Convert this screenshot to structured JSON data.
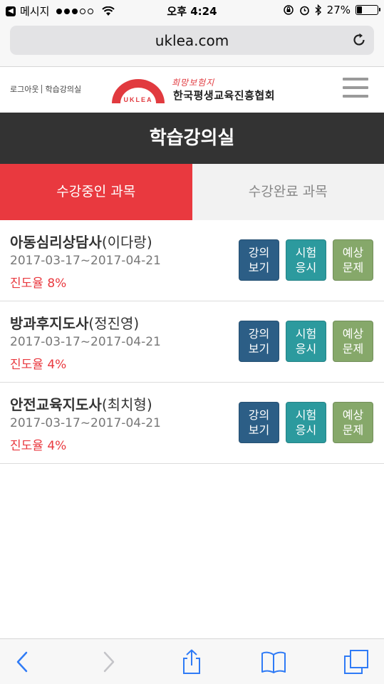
{
  "status_bar": {
    "back_app": "메시지",
    "time": "오후 4:24",
    "battery": "27%",
    "battery_level": 0.27
  },
  "browser": {
    "url": "uklea.com"
  },
  "header": {
    "login_link": "로그아웃",
    "classroom_link": "학습강의실",
    "logo_mark": "UKLEA",
    "logo_slogan": "희망보험지",
    "logo_name": "한국평생교육진흥협회"
  },
  "page": {
    "title": "학습강의실"
  },
  "tabs": [
    {
      "label": "수강중인 과목",
      "active": true
    },
    {
      "label": "수강완료 과목",
      "active": false
    }
  ],
  "courses": [
    {
      "name": "아동심리상담사",
      "instructor": "(이다랑)",
      "period": "2017-03-17~2017-04-21",
      "progress": "진도율 8%",
      "buttons": [
        {
          "line1": "강의",
          "line2": "보기"
        },
        {
          "line1": "시험",
          "line2": "응시"
        },
        {
          "line1": "예상",
          "line2": "문제"
        }
      ]
    },
    {
      "name": "방과후지도사",
      "instructor": "(정진영)",
      "period": "2017-03-17~2017-04-21",
      "progress": "진도율 4%",
      "buttons": [
        {
          "line1": "강의",
          "line2": "보기"
        },
        {
          "line1": "시험",
          "line2": "응시"
        },
        {
          "line1": "예상",
          "line2": "문제"
        }
      ]
    },
    {
      "name": "안전교육지도사",
      "instructor": "(최치형)",
      "period": "2017-03-17~2017-04-21",
      "progress": "진도율 4%",
      "buttons": [
        {
          "line1": "강의",
          "line2": "보기"
        },
        {
          "line1": "시험",
          "line2": "응시"
        },
        {
          "line1": "예상",
          "line2": "문제"
        }
      ]
    }
  ],
  "colors": {
    "accent_red": "#e9393f",
    "title_bar": "#333333",
    "lecture_button": "#2c5e86",
    "exam_button": "#2c9a9e",
    "preview_button": "#86a86a",
    "ios_blue": "#2f7bf6"
  },
  "icons": {
    "toolbar": [
      "back-arrow-icon",
      "forward-arrow-icon",
      "share-icon",
      "bookmarks-icon",
      "tabs-icon"
    ]
  }
}
